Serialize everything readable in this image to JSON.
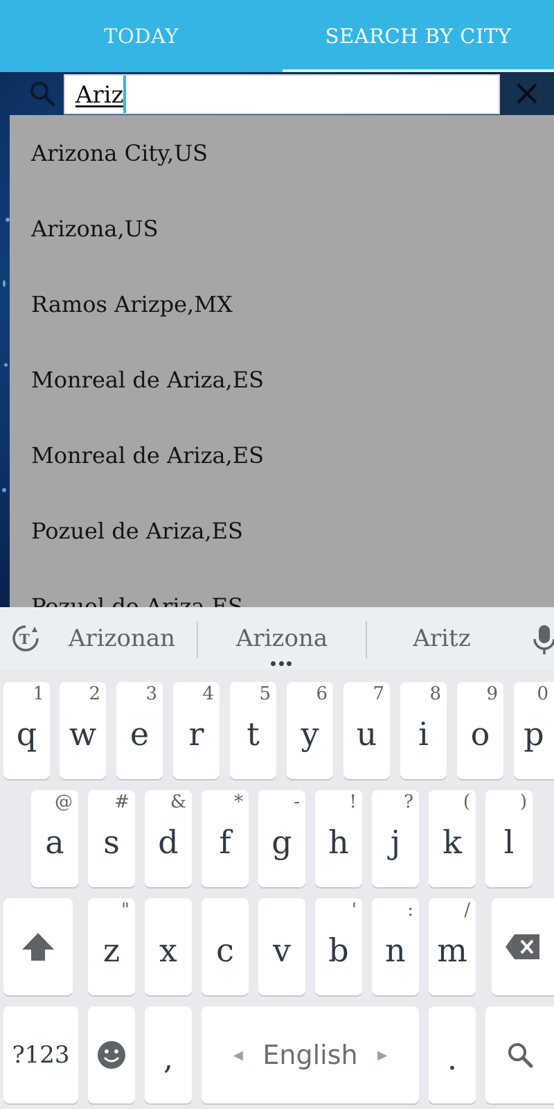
{
  "tabs": {
    "today": "TODAY",
    "search_by_city": "SEARCH BY CITY"
  },
  "search": {
    "value": "Ariz"
  },
  "suggestions": [
    "Arizona City,US",
    "Arizona,US",
    "Ramos Arizpe,MX",
    "Monreal de Ariza,ES",
    "Monreal de Ariza,ES",
    "Pozuel de Ariza,ES",
    "Pozuel de Ariza,ES"
  ],
  "keyboard": {
    "word_suggestions": [
      "Arizonan",
      "Arizona",
      "Aritz"
    ],
    "row1": [
      {
        "key": "q",
        "hint": "1"
      },
      {
        "key": "w",
        "hint": "2"
      },
      {
        "key": "e",
        "hint": "3"
      },
      {
        "key": "r",
        "hint": "4"
      },
      {
        "key": "t",
        "hint": "5"
      },
      {
        "key": "y",
        "hint": "6"
      },
      {
        "key": "u",
        "hint": "7"
      },
      {
        "key": "i",
        "hint": "8"
      },
      {
        "key": "o",
        "hint": "9"
      },
      {
        "key": "p",
        "hint": "0"
      }
    ],
    "row2": [
      {
        "key": "a",
        "hint": "@"
      },
      {
        "key": "s",
        "hint": "#"
      },
      {
        "key": "d",
        "hint": "&"
      },
      {
        "key": "f",
        "hint": "*"
      },
      {
        "key": "g",
        "hint": "-"
      },
      {
        "key": "h",
        "hint": "!"
      },
      {
        "key": "j",
        "hint": "?"
      },
      {
        "key": "k",
        "hint": "("
      },
      {
        "key": "l",
        "hint": ")"
      }
    ],
    "row3": [
      {
        "key": "z",
        "hint": "\""
      },
      {
        "key": "x",
        "hint": ""
      },
      {
        "key": "c",
        "hint": ""
      },
      {
        "key": "v",
        "hint": ""
      },
      {
        "key": "b",
        "hint": "'"
      },
      {
        "key": "n",
        "hint": ":"
      },
      {
        "key": "m",
        "hint": "/"
      }
    ],
    "symbols_label": "?123",
    "comma": ",",
    "space_label": "English",
    "period": "."
  },
  "colors": {
    "tab_bar": "#35b5e4",
    "dropdown": "#a6a6a6",
    "keyboard_bg": "#e8eaed"
  },
  "icons": [
    "search-icon",
    "close-icon",
    "translate-icon",
    "microphone-icon",
    "shift-icon",
    "backspace-icon",
    "emoji-icon",
    "keyboard-search-icon"
  ]
}
